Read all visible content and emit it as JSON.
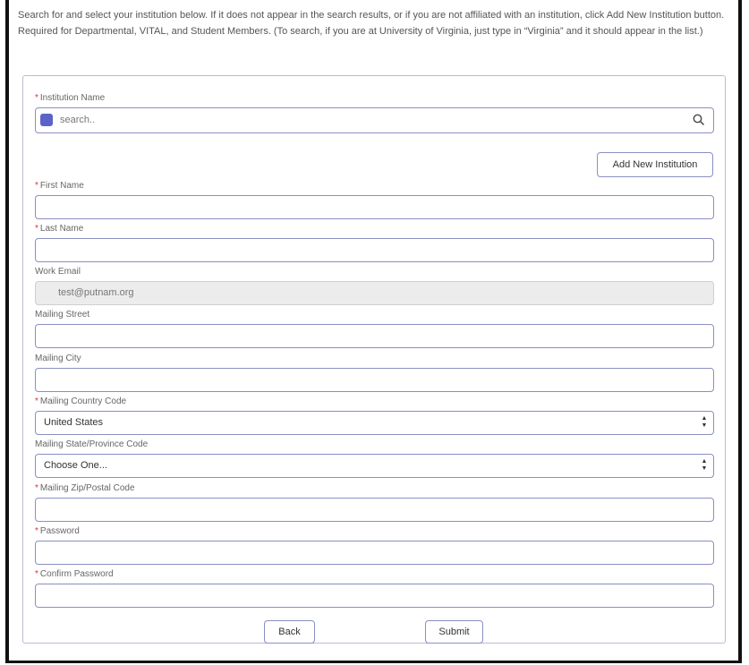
{
  "intro_text": "Search for and select your institution below. If it does not appear in the search results, or if you are not affiliated with an institution, click Add New Institution button. Required for Departmental, VITAL, and Student Members. (To search, if you are at University of Virginia, just type in “Virginia” and it should appear in the list.)",
  "institution": {
    "label": "Institution Name",
    "required": true,
    "placeholder": "search..",
    "search_icon": "search-icon"
  },
  "add_institution_label": "Add New Institution",
  "fields": {
    "first_name": {
      "label": "First Name",
      "value": ""
    },
    "last_name": {
      "label": "Last Name",
      "value": ""
    },
    "work_email": {
      "label": "Work Email",
      "value": "test@putnam.org"
    },
    "mailing_street": {
      "label": "Mailing Street",
      "value": ""
    },
    "mailing_city": {
      "label": "Mailing City",
      "value": ""
    },
    "country_code": {
      "label": "Mailing Country Code",
      "value": "United States"
    },
    "state_code": {
      "label": "Mailing State/Province Code",
      "value": "Choose One..."
    },
    "zip_code": {
      "label": "Mailing Zip/Postal Code",
      "value": ""
    },
    "password": {
      "label": "Password",
      "value": ""
    },
    "confirm_password": {
      "label": "Confirm Password",
      "value": ""
    }
  },
  "required_marker": "*",
  "back_label": "Back",
  "submit_label": "Submit",
  "colors": {
    "accent": "#5b63c8",
    "border": "#8a8fc2",
    "required": "#dd3333"
  }
}
